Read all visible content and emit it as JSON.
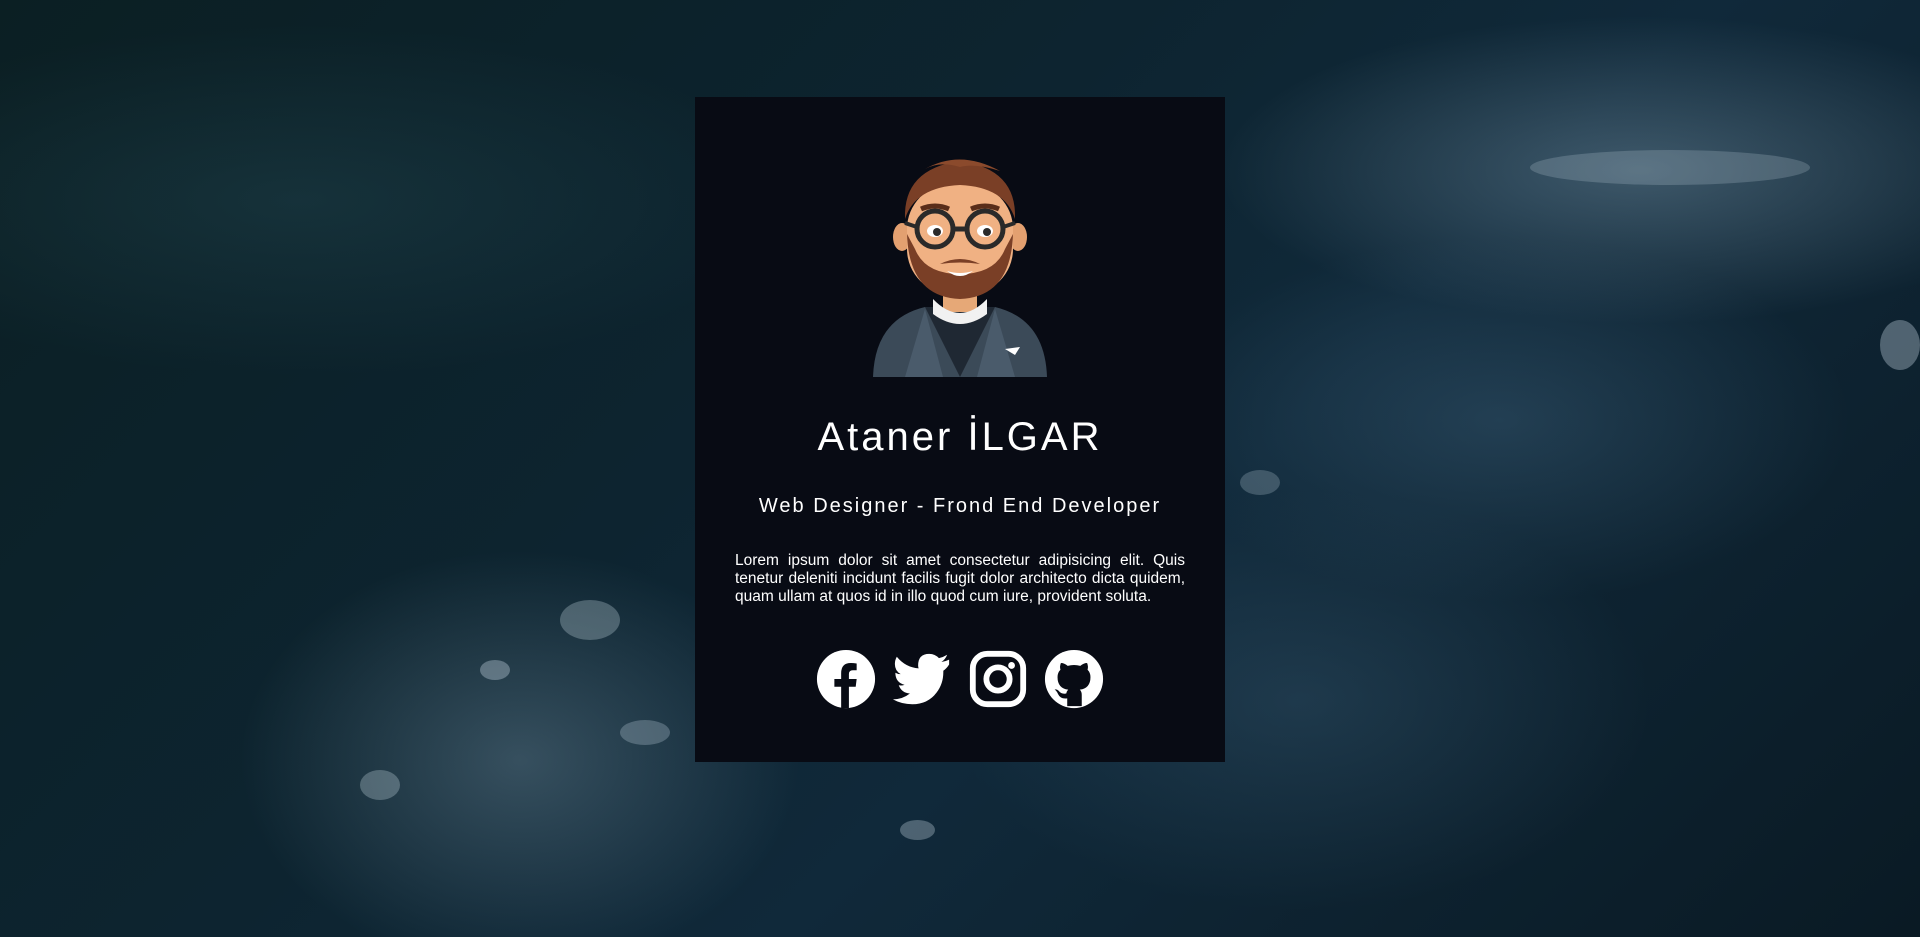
{
  "profile": {
    "name": "Ataner İLGAR",
    "title": "Web Designer - Frond End Developer",
    "bio": "Lorem ipsum dolor sit amet consectetur adipisicing elit. Quis tenetur deleniti incidunt facilis fugit dolor architecto dicta quidem, quam ullam at quos id in illo quod cum iure, provident soluta."
  },
  "socials": [
    {
      "icon": "facebook-icon"
    },
    {
      "icon": "twitter-icon"
    },
    {
      "icon": "instagram-icon"
    },
    {
      "icon": "github-icon"
    }
  ],
  "colors": {
    "card_background": "#080b14",
    "text": "#ffffff",
    "ocean": "#0d2430"
  }
}
